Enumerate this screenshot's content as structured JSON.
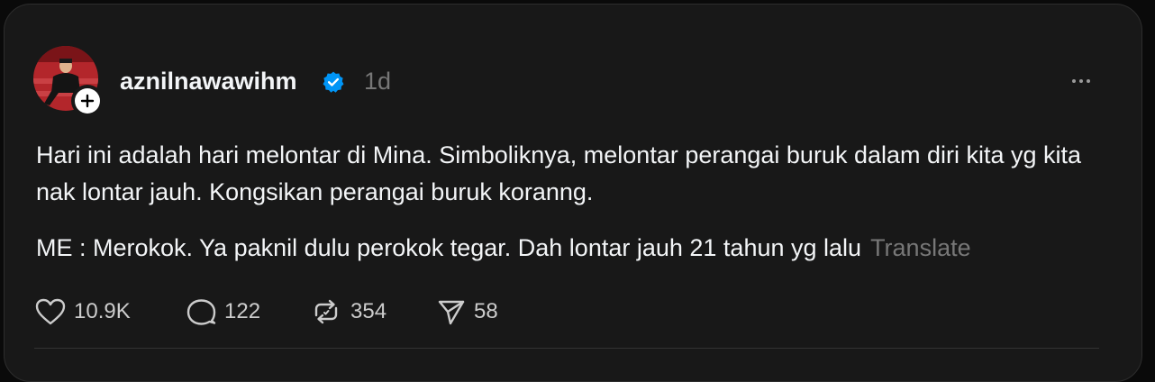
{
  "post": {
    "username": "aznilnawawihm",
    "time": "1d",
    "paragraphs": [
      "Hari ini adalah hari melontar di Mina. Simboliknya, melontar perangai buruk dalam diri kita yg kita nak lontar jauh. Kongsikan perangai buruk koranng.",
      "ME : Merokok. Ya paknil dulu perokok tegar. Dah lontar jauh 21 tahun yg lalu"
    ],
    "translate_label": "Translate"
  },
  "actions": {
    "likes": "10.9K",
    "comments": "122",
    "reposts": "354",
    "shares": "58"
  },
  "colors": {
    "background": "#181818",
    "text": "#f3f5f7",
    "muted": "#777777",
    "verified": "#0095f6"
  }
}
